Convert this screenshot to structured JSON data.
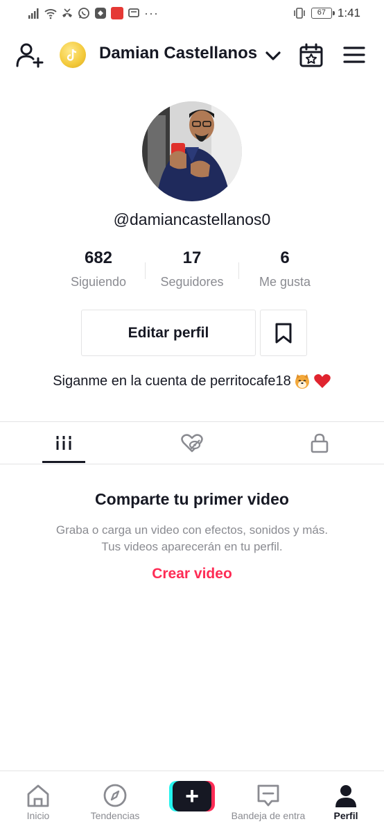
{
  "status_bar": {
    "time": "1:41",
    "battery": "67",
    "more": "···",
    "icons": [
      "signal-icon",
      "wifi-icon",
      "missed-call-icon",
      "whatsapp-icon",
      "app-icon",
      "app-red-icon",
      "message-icon",
      "vibrate-icon",
      "battery-icon"
    ]
  },
  "header": {
    "title": "Damian Castellanos",
    "icons": [
      "add-user-icon",
      "coin-icon",
      "chevron-down-icon",
      "calendar-star-icon",
      "menu-icon"
    ]
  },
  "profile": {
    "handle": "@damiancastellanos0",
    "stats": [
      {
        "value": "682",
        "label": "Siguiendo"
      },
      {
        "value": "17",
        "label": "Seguidores"
      },
      {
        "value": "6",
        "label": "Me gusta"
      }
    ],
    "edit_button": "Editar perfil",
    "bio": "Siganme en la cuenta de perritocafe18"
  },
  "tabs": {
    "items": [
      "videos-grid-icon",
      "liked-hidden-icon",
      "lock-icon"
    ],
    "active": 0
  },
  "empty_state": {
    "title": "Comparte tu primer video",
    "description": "Graba o carga un video con efectos, sonidos y más. Tus videos aparecerán en tu perfil.",
    "action": "Crear video"
  },
  "bottom_nav": {
    "items": [
      {
        "label": "Inicio",
        "icon": "home-icon"
      },
      {
        "label": "Tendencias",
        "icon": "compass-icon"
      },
      {
        "label": "",
        "icon": "create-plus-icon"
      },
      {
        "label": "Bandeja de entra",
        "icon": "inbox-icon"
      },
      {
        "label": "Perfil",
        "icon": "profile-icon"
      }
    ],
    "active": 4
  },
  "colors": {
    "accent": "#fe2c55",
    "cyan": "#25f4ee",
    "text": "#161823",
    "muted": "#8a8b91",
    "border": "#e3e3e4"
  }
}
